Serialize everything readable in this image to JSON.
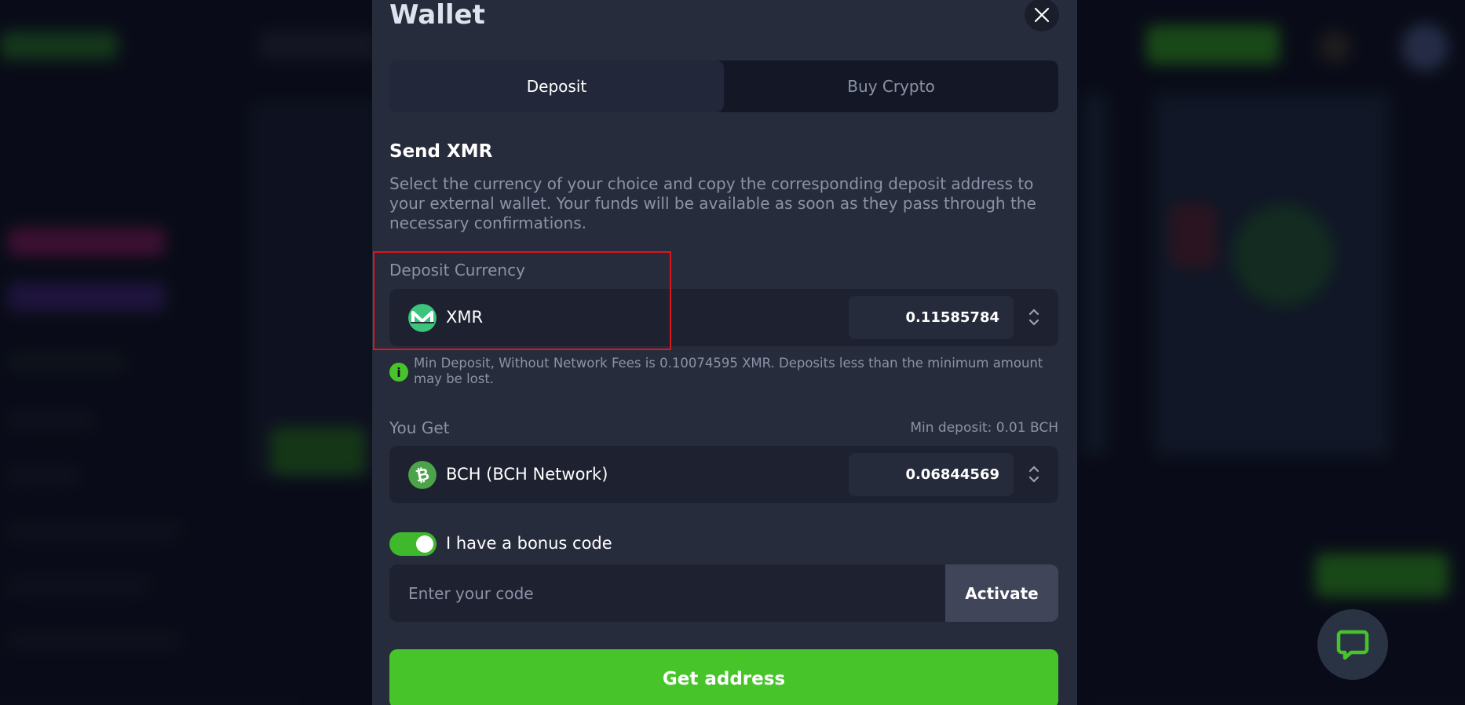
{
  "modal": {
    "title": "Wallet",
    "tabs": [
      {
        "label": "Deposit",
        "active": true
      },
      {
        "label": "Buy Crypto",
        "active": false
      }
    ],
    "send_title": "Send XMR",
    "description": "Select the currency of your choice and copy the corresponding deposit address to your external wallet. Your funds will be available as soon as they pass through the necessary confirmations.",
    "deposit": {
      "label": "Deposit Currency",
      "currency": "XMR",
      "icon": "monero-icon",
      "amount": "0.11585784"
    },
    "info_note": "Min Deposit, Without Network Fees is 0.10074595 XMR. Deposits less than the minimum amount may be lost.",
    "you_get": {
      "label": "You Get",
      "min_deposit": "Min deposit: 0.01 BCH",
      "currency": "BCH (BCH Network)",
      "icon": "bitcoin-cash-icon",
      "amount": "0.06844569"
    },
    "bonus": {
      "toggle_on": true,
      "label": "I have a bonus code",
      "input_placeholder": "Enter your code",
      "input_value": "",
      "activate_label": "Activate"
    },
    "get_address_label": "Get address"
  },
  "colors": {
    "accent_green": "#46c42a",
    "modal_bg": "#272c3c",
    "field_bg": "#1d2130",
    "highlight_red": "#e0151c",
    "monero_green": "#3cc47c",
    "bch_green": "#4ca44a"
  }
}
